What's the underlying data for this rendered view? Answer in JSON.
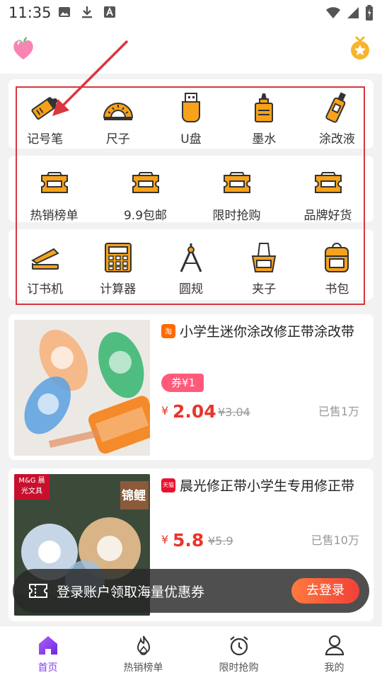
{
  "status_bar": {
    "time": "11:35"
  },
  "categories": {
    "row1": [
      {
        "label": "记号笔",
        "icon": "marker-icon"
      },
      {
        "label": "尺子",
        "icon": "ruler-icon"
      },
      {
        "label": "U盘",
        "icon": "usb-drive-icon"
      },
      {
        "label": "墨水",
        "icon": "ink-bottle-icon"
      },
      {
        "label": "涂改液",
        "icon": "correction-fluid-icon"
      }
    ],
    "row2": [
      {
        "label": "热销榜单",
        "icon": "ticket-icon"
      },
      {
        "label": "9.9包邮",
        "icon": "ticket-icon"
      },
      {
        "label": "限时抢购",
        "icon": "ticket-icon"
      },
      {
        "label": "品牌好货",
        "icon": "ticket-icon"
      }
    ],
    "row3": [
      {
        "label": "订书机",
        "icon": "stapler-icon"
      },
      {
        "label": "计算器",
        "icon": "calculator-icon"
      },
      {
        "label": "圆规",
        "icon": "compass-icon"
      },
      {
        "label": "夹子",
        "icon": "binder-clip-icon"
      },
      {
        "label": "书包",
        "icon": "backpack-icon"
      }
    ]
  },
  "products": [
    {
      "platform": "淘",
      "platform_color": "#ff6a00",
      "title": "小学生迷你涂改修正带涂改带",
      "coupon": "券¥1",
      "currency": "¥",
      "price": "2.04",
      "old_price": "¥3.04",
      "sold": "已售1万"
    },
    {
      "platform": "天猫",
      "platform_color": "#e8112d",
      "title": "晨光修正带小学生专用修正带",
      "currency": "¥",
      "price": "5.8",
      "old_price": "¥5.9",
      "sold": "已售10万",
      "image_brand_text": "M&G 晨光文具",
      "image_overlay_text": "锦鲤"
    }
  ],
  "login_banner": {
    "text": "登录账户领取海量优惠券",
    "button": "去登录"
  },
  "bottom_nav": [
    {
      "label": "首页",
      "icon": "home-icon",
      "active": true
    },
    {
      "label": "热销榜单",
      "icon": "flame-icon",
      "active": false
    },
    {
      "label": "限时抢购",
      "icon": "alarm-clock-icon",
      "active": false
    },
    {
      "label": "我的",
      "icon": "user-icon",
      "active": false
    }
  ],
  "colors": {
    "accent": "#8a3ff0",
    "price": "#e8352c",
    "icon_orange": "#f7a21a",
    "highlight": "#d9363e"
  }
}
